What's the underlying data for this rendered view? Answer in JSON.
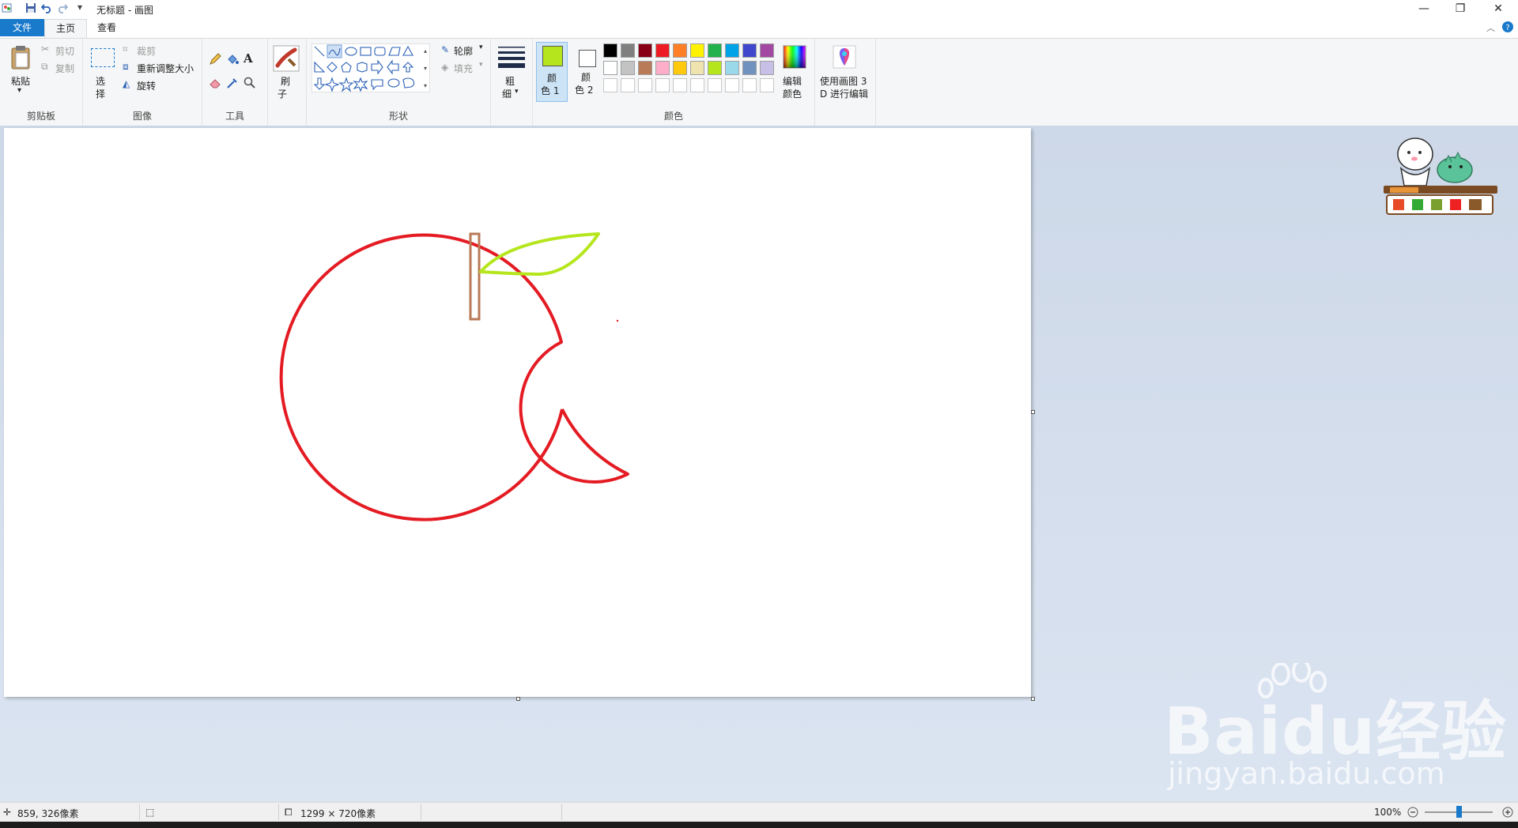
{
  "window": {
    "title": "无标题 - 画图",
    "minimize_glyph": "—",
    "restore_glyph": "❐",
    "close_glyph": "✕"
  },
  "tabs": {
    "file": "文件",
    "home": "主页",
    "view": "查看"
  },
  "ribbon": {
    "clipboard": {
      "paste": "粘贴",
      "paste_arrow": "▾",
      "cut": "剪切",
      "copy": "复制",
      "label": "剪贴板"
    },
    "image": {
      "select_1": "选",
      "select_2": "择",
      "crop": "裁剪",
      "resize": "重新调整大小",
      "rotate": "旋转",
      "label": "图像"
    },
    "tools": {
      "label": "工具",
      "text_glyph": "A"
    },
    "brush": {
      "label_1": "刷",
      "label_2": "子"
    },
    "shapes": {
      "outline": "轮廓",
      "fill": "填充",
      "label": "形状"
    },
    "size": {
      "label_1": "粗",
      "label_2": "细"
    },
    "color1": {
      "label_1": "颜",
      "label_2": "色 1",
      "value": "#b5e61d"
    },
    "color2": {
      "label_1": "颜",
      "label_2": "色 2",
      "value": "#ffffff"
    },
    "colors": {
      "label": "颜色",
      "row1": [
        "#000000",
        "#7f7f7f",
        "#880015",
        "#ed1c24",
        "#ff7f27",
        "#fff200",
        "#22b14c",
        "#00a2e8",
        "#3f48cc",
        "#a349a4"
      ],
      "row2": [
        "#ffffff",
        "#c3c3c3",
        "#b97a57",
        "#ffaec9",
        "#ffc90e",
        "#efe4b0",
        "#b5e61d",
        "#99d9ea",
        "#7092be",
        "#c8bfe7"
      ]
    },
    "edit_colors": {
      "label_1": "编辑",
      "label_2": "颜色"
    },
    "paint3d": {
      "label_1": "使用画图 3",
      "label_2": "D 进行编辑"
    }
  },
  "drawing": {
    "apple_color": "#e41b23",
    "stem_color": "#b97a57",
    "leaf_color": "#b5e61d"
  },
  "status": {
    "cursor_pos": "859, 326像素",
    "canvas_size": "1299 × 720像素",
    "zoom": "100%"
  },
  "watermark": {
    "brand": "Baidu经验",
    "url": "jingyan.baidu.com"
  }
}
